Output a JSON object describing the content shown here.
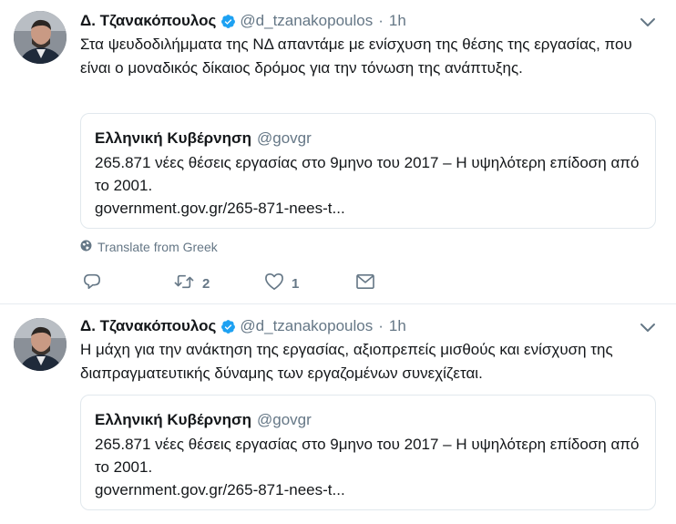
{
  "colors": {
    "text": "#14171a",
    "muted": "#657786",
    "border": "#e1e8ed",
    "verified": "#1da1f2"
  },
  "tweets": [
    {
      "name": "Δ. Τζανακόπουλος",
      "handle": "@d_tzanakopoulos",
      "dot": "·",
      "time": "1h",
      "text": "Στα ψευδοδιλήμματα της ΝΔ απαντάμε με ενίσχυση της θέσης της εργασίας, που είναι ο μοναδικός δίκαιος δρόμος για την τόνωση της ανάπτυξης.",
      "quote": {
        "name": "Ελληνική Κυβέρνηση",
        "handle": "@govgr",
        "body": "265.871 νέες θέσεις εργασίας στο 9μηνο του 2017 – Η υψηλότερη επίδοση από το 2001.",
        "link": "government.gov.gr/265-871-nees-t..."
      },
      "translate": "Translate from Greek",
      "retweets": "2",
      "likes": "1"
    },
    {
      "name": "Δ. Τζανακόπουλος",
      "handle": "@d_tzanakopoulos",
      "dot": "·",
      "time": "1h",
      "text": "Η μάχη για την ανάκτηση της εργασίας, αξιοπρεπείς μισθούς και ενίσχυση της διαπραγματευτικής δύναμης των εργαζομένων συνεχίζεται.",
      "quote": {
        "name": "Ελληνική Κυβέρνηση",
        "handle": "@govgr",
        "body": "265.871 νέες θέσεις εργασίας στο 9μηνο του 2017 – Η υψηλότερη επίδοση από το 2001.",
        "link": "government.gov.gr/265-871-nees-t..."
      }
    }
  ],
  "icons": {
    "verified": "verified-badge-icon",
    "caret": "chevron-down-icon",
    "globe": "globe-icon",
    "reply": "reply-icon",
    "retweet": "retweet-icon",
    "like": "heart-icon",
    "dm": "envelope-icon"
  }
}
